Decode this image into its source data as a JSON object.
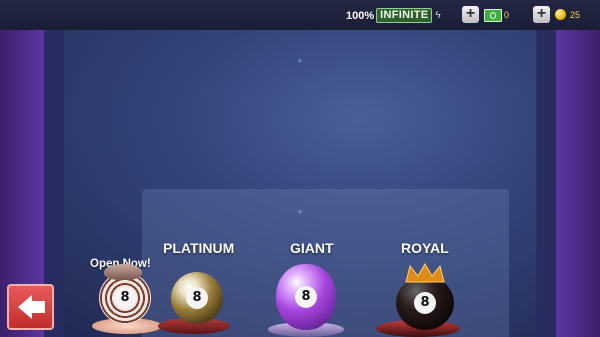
{
  "topbar": {
    "energy_percent": "100%",
    "energy_label": "INFINITE",
    "cash_value": "0",
    "coins_value": "25"
  },
  "cues": {
    "open_now_label": "Open Now!",
    "platinum_label": "PLATINUM",
    "giant_label": "GIANT",
    "royal_label": "ROYAL",
    "ball_number": "8"
  },
  "icons": {
    "back": "back-arrow-icon",
    "add_cash": "plus-icon",
    "add_coins": "plus-icon",
    "cash": "cash-icon",
    "coin": "coin-icon",
    "energy": "lightning-icon"
  },
  "colors": {
    "back_button": "#d84040",
    "infinite_bg": "#2f5e2f",
    "currency_text": "#f3d35b",
    "giant_ball": "#9b3fd8",
    "royal_crown": "#e08a1a"
  }
}
